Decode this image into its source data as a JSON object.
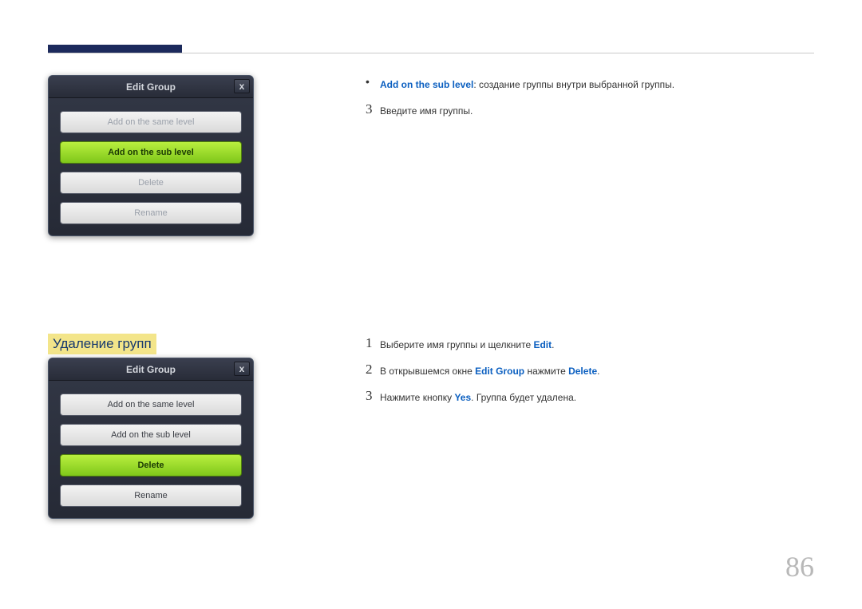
{
  "page_number": "86",
  "section_title": "Удаление групп",
  "dialog1": {
    "title": "Edit Group",
    "close": "x",
    "items": [
      {
        "label": "Add on the same level",
        "sel": false,
        "dark": false
      },
      {
        "label": "Add on the sub level",
        "sel": true,
        "dark": false
      },
      {
        "label": "Delete",
        "sel": false,
        "dark": false
      },
      {
        "label": "Rename",
        "sel": false,
        "dark": false
      }
    ]
  },
  "dialog2": {
    "title": "Edit Group",
    "close": "x",
    "items": [
      {
        "label": "Add on the same level",
        "sel": false,
        "dark": true
      },
      {
        "label": "Add on the sub level",
        "sel": false,
        "dark": true
      },
      {
        "label": "Delete",
        "sel": true,
        "dark": false
      },
      {
        "label": "Rename",
        "sel": false,
        "dark": true
      }
    ]
  },
  "right1": {
    "bullet": {
      "strong": "Add on the sub level",
      "rest": ": создание группы внутри выбранной группы."
    },
    "step3": {
      "num": "3",
      "text": "Введите имя группы."
    }
  },
  "right2": {
    "step1": {
      "num": "1",
      "pre": "Выберите имя группы и щелкните ",
      "strong": "Edit",
      "post": "."
    },
    "step2": {
      "num": "2",
      "pre": "В открывшемся окне ",
      "strong1": "Edit Group",
      "mid": " нажмите ",
      "strong2": "Delete",
      "post": "."
    },
    "step3": {
      "num": "3",
      "pre": "Нажмите кнопку ",
      "strong": "Yes",
      "post": ". Группа будет удалена."
    }
  }
}
